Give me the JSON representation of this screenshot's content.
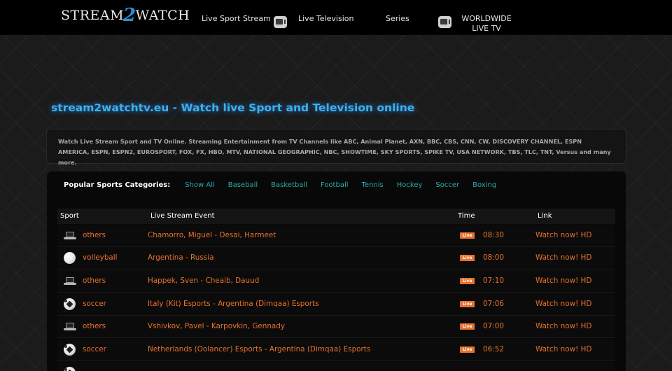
{
  "header": {
    "logo": {
      "part1": "Stream",
      "part2": "2",
      "part3": "Watch"
    },
    "nav": [
      {
        "label": "Live Sport Stream",
        "icon": null
      },
      {
        "label": "Live Television",
        "icon": "tv-icon"
      },
      {
        "label": "Series",
        "icon": null
      },
      {
        "label": "WORLDWIDE LIVE TV",
        "icon": "tv-icon"
      }
    ]
  },
  "main": {
    "title": "stream2watchtv.eu - Watch live Sport and Television online",
    "description": "Watch Live Stream Sport and TV Online. Streaming Entertainment from TV Channels like ABC, Animal Planet, AXN, BBC, CBS, CNN, CW, DISCOVERY CHANNEL, ESPN AMERICA, ESPN, ESPN2, EUROSPORT, FOX, FX, HBO, MTV, NATIONAL GEOGRAPHIC, NBC, SHOWTIME, SKY SPORTS, SPIKE TV, USA NETWORK, TBS, TLC, TNT, Versus and many more.",
    "categories_label": "Popular Sports Categories:",
    "categories": [
      "Show All",
      "Baseball",
      "Basketball",
      "Football",
      "Tennis",
      "Hockey",
      "Soccer",
      "Boxing"
    ],
    "table": {
      "headers": {
        "sport": "Sport",
        "event": "Live Stream Event",
        "time": "Time",
        "link": "Link"
      },
      "live_badge": "Live",
      "rows": [
        {
          "icon": "laptop-icon",
          "sport": "others",
          "event": "Chamorro, Miguel - Desai, Harmeet",
          "time": "08:30",
          "link": "Watch now! HD"
        },
        {
          "icon": "volleyball-icon",
          "sport": "volleyball",
          "event": "Argentina - Russia",
          "time": "08:00",
          "link": "Watch now! HD"
        },
        {
          "icon": "laptop-icon",
          "sport": "others",
          "event": "Happek, Sven - Cheaib, Dauud",
          "time": "07:10",
          "link": "Watch now! HD"
        },
        {
          "icon": "soccer-ball-icon",
          "sport": "soccer",
          "event": "Italy (Kit) Esports - Argentina (Dimqaa) Esports",
          "time": "07:06",
          "link": "Watch now! HD"
        },
        {
          "icon": "laptop-icon",
          "sport": "others",
          "event": "Vshivkov, Pavel - Karpovkin, Gennady",
          "time": "07:00",
          "link": "Watch now! HD"
        },
        {
          "icon": "soccer-ball-icon",
          "sport": "soccer",
          "event": "Netherlands (Oolancer) Esports - Argentina (Dimqaa) Esports",
          "time": "06:52",
          "link": "Watch now! HD"
        },
        {
          "icon": "soccer-ball-icon",
          "sport": "",
          "event": "",
          "time": "",
          "link": ""
        }
      ]
    }
  },
  "colors": {
    "accent_title": "#3ab1f0",
    "category_link": "#2fa8a8",
    "row_text": "#e8722c",
    "background": "#1b1b1b"
  }
}
